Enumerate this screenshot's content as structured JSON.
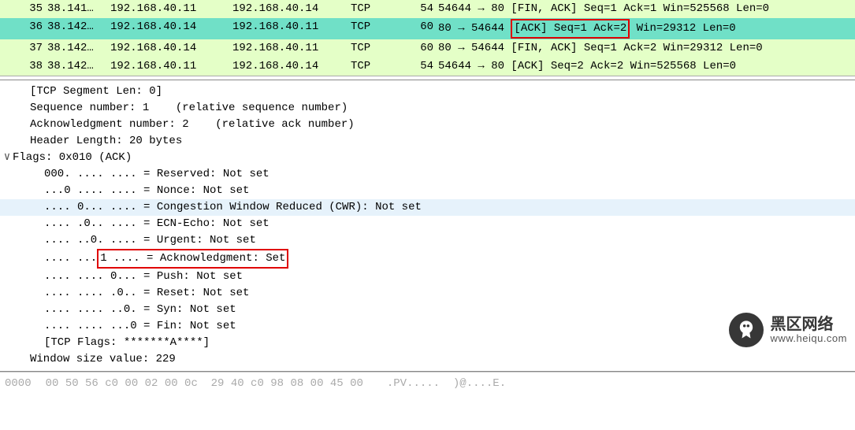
{
  "packets": [
    {
      "no": "35",
      "time": "38.141…",
      "src": "192.168.40.11",
      "dst": "192.168.40.14",
      "proto": "TCP",
      "len": "54",
      "info_pre": "54644 → 80 [FIN, ACK] Seq=1 Ack=1 Win=525568 Len=0",
      "selected": false,
      "boxed": null
    },
    {
      "no": "36",
      "time": "38.142…",
      "src": "192.168.40.14",
      "dst": "192.168.40.11",
      "proto": "TCP",
      "len": "60",
      "info_pre": "80 → 54644 ",
      "boxed": "[ACK] Seq=1 Ack=2",
      "info_post": " Win=29312 Len=0",
      "selected": true
    },
    {
      "no": "37",
      "time": "38.142…",
      "src": "192.168.40.14",
      "dst": "192.168.40.11",
      "proto": "TCP",
      "len": "60",
      "info_pre": "80 → 54644 [FIN, ACK] Seq=1 Ack=2 Win=29312 Len=0",
      "selected": false,
      "boxed": null
    },
    {
      "no": "38",
      "time": "38.142…",
      "src": "192.168.40.11",
      "dst": "192.168.40.14",
      "proto": "TCP",
      "len": "54",
      "info_pre": "54644 → 80 [ACK] Seq=2 Ack=2 Win=525568 Len=0",
      "selected": false,
      "boxed": null
    }
  ],
  "details": {
    "seg_len": "[TCP Segment Len: 0]",
    "seq": "Sequence number: 1    (relative sequence number)",
    "ack": "Acknowledgment number: 2    (relative ack number)",
    "hdr": "Header Length: 20 bytes",
    "flags_hdr": "Flags: 0x010 (ACK)",
    "flag_reserved": "000. .... .... = Reserved: Not set",
    "flag_nonce": "...0 .... .... = Nonce: Not set",
    "flag_cwr": ".... 0... .... = Congestion Window Reduced (CWR): Not set",
    "flag_ecn": ".... .0.. .... = ECN-Echo: Not set",
    "flag_urg": ".... ..0. .... = Urgent: Not set",
    "flag_ack_pre": ".... ...",
    "flag_ack_box": "1 .... = Acknowledgment: Set",
    "flag_push": ".... .... 0... = Push: Not set",
    "flag_reset": ".... .... .0.. = Reset: Not set",
    "flag_syn": ".... .... ..0. = Syn: Not set",
    "flag_fin": ".... .... ...0 = Fin: Not set",
    "tcp_flags": "[TCP Flags: *******A****]",
    "win_size": "Window size value: 229"
  },
  "hex": {
    "offset": "0000",
    "bytes": "00 50 56 c0 00 02 00 0c  29 40 c0 98 08 00 45 00",
    "ascii": ".PV.....  )@....E."
  },
  "watermark": {
    "title": "黑区网络",
    "url": "www.heiqu.com"
  }
}
